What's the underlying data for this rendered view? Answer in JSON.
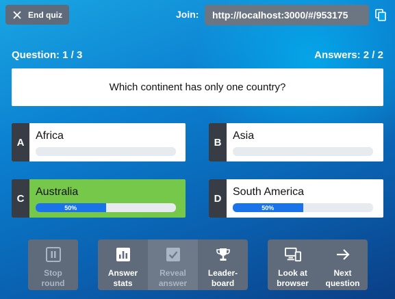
{
  "header": {
    "end_quiz_label": "End quiz",
    "join_label": "Join:",
    "join_url": "http://localhost:3000/#/953175"
  },
  "status": {
    "question_counter": "Question: 1 / 3",
    "answers_counter": "Answers: 2 / 2"
  },
  "question": {
    "text": "Which continent has only one country?"
  },
  "answers": [
    {
      "letter": "A",
      "text": "Africa",
      "percent": 0,
      "label": ""
    },
    {
      "letter": "B",
      "text": "Asia",
      "percent": 0,
      "label": ""
    },
    {
      "letter": "C",
      "text": "Australia",
      "percent": 50,
      "label": "50%",
      "correct": true
    },
    {
      "letter": "D",
      "text": "South America",
      "percent": 50,
      "label": "50%"
    }
  ],
  "controls": {
    "stop_round": "Stop\nround",
    "answer_stats": "Answer\nstats",
    "reveal_answer": "Reveal\nanswer",
    "leaderboard": "Leader-\nboard",
    "look_at_browser": "Look at\nbrowser",
    "next_question": "Next\nquestion"
  },
  "colors": {
    "correct": "#76c84a",
    "bar_fill": "#1a73e8",
    "button_bg": "#5f6b7a"
  }
}
